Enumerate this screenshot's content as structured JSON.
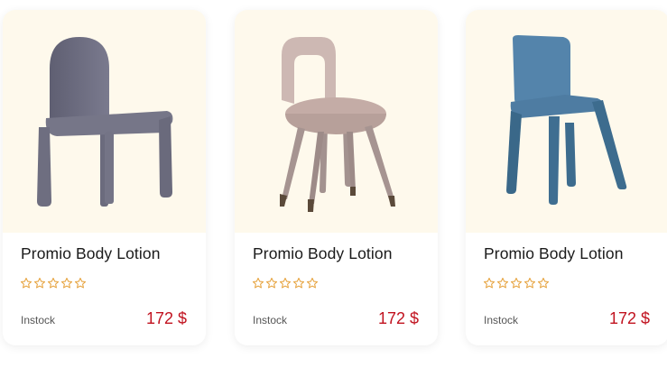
{
  "colors": {
    "image_bg": "#fef9ec",
    "price": "#c1121f",
    "star": "#e6a23c"
  },
  "products": [
    {
      "title": "Promio Body Lotion",
      "rating_icon": "star-outline-icon",
      "rating_count": 5,
      "stock": "Instock",
      "price": "172 $",
      "image": "grey-upholstered-chair"
    },
    {
      "title": "Promio Body Lotion",
      "rating_icon": "star-outline-icon",
      "rating_count": 5,
      "stock": "Instock",
      "price": "172 $",
      "image": "pink-velvet-chair"
    },
    {
      "title": "Promio Body Lotion",
      "rating_icon": "star-outline-icon",
      "rating_count": 5,
      "stock": "Instock",
      "price": "172 $",
      "image": "blue-modern-chair"
    }
  ]
}
